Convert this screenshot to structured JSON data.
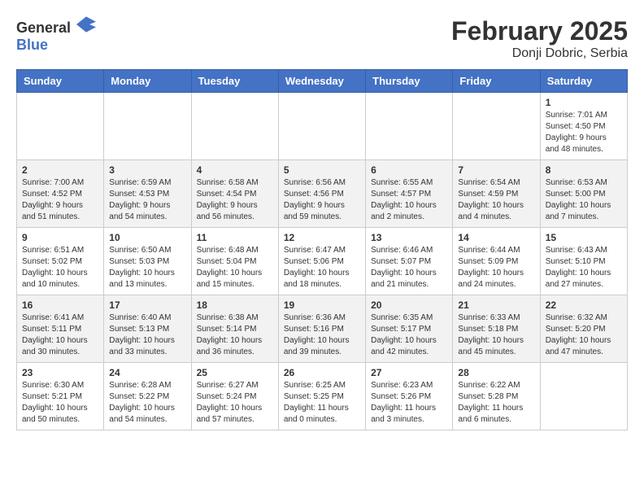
{
  "header": {
    "logo": {
      "general": "General",
      "blue": "Blue"
    },
    "title": "February 2025",
    "subtitle": "Donji Dobric, Serbia"
  },
  "days_of_week": [
    "Sunday",
    "Monday",
    "Tuesday",
    "Wednesday",
    "Thursday",
    "Friday",
    "Saturday"
  ],
  "weeks": [
    {
      "days": [
        {
          "number": "",
          "info": ""
        },
        {
          "number": "",
          "info": ""
        },
        {
          "number": "",
          "info": ""
        },
        {
          "number": "",
          "info": ""
        },
        {
          "number": "",
          "info": ""
        },
        {
          "number": "",
          "info": ""
        },
        {
          "number": "1",
          "info": "Sunrise: 7:01 AM\nSunset: 4:50 PM\nDaylight: 9 hours and 48 minutes."
        }
      ]
    },
    {
      "days": [
        {
          "number": "2",
          "info": "Sunrise: 7:00 AM\nSunset: 4:52 PM\nDaylight: 9 hours and 51 minutes."
        },
        {
          "number": "3",
          "info": "Sunrise: 6:59 AM\nSunset: 4:53 PM\nDaylight: 9 hours and 54 minutes."
        },
        {
          "number": "4",
          "info": "Sunrise: 6:58 AM\nSunset: 4:54 PM\nDaylight: 9 hours and 56 minutes."
        },
        {
          "number": "5",
          "info": "Sunrise: 6:56 AM\nSunset: 4:56 PM\nDaylight: 9 hours and 59 minutes."
        },
        {
          "number": "6",
          "info": "Sunrise: 6:55 AM\nSunset: 4:57 PM\nDaylight: 10 hours and 2 minutes."
        },
        {
          "number": "7",
          "info": "Sunrise: 6:54 AM\nSunset: 4:59 PM\nDaylight: 10 hours and 4 minutes."
        },
        {
          "number": "8",
          "info": "Sunrise: 6:53 AM\nSunset: 5:00 PM\nDaylight: 10 hours and 7 minutes."
        }
      ]
    },
    {
      "days": [
        {
          "number": "9",
          "info": "Sunrise: 6:51 AM\nSunset: 5:02 PM\nDaylight: 10 hours and 10 minutes."
        },
        {
          "number": "10",
          "info": "Sunrise: 6:50 AM\nSunset: 5:03 PM\nDaylight: 10 hours and 13 minutes."
        },
        {
          "number": "11",
          "info": "Sunrise: 6:48 AM\nSunset: 5:04 PM\nDaylight: 10 hours and 15 minutes."
        },
        {
          "number": "12",
          "info": "Sunrise: 6:47 AM\nSunset: 5:06 PM\nDaylight: 10 hours and 18 minutes."
        },
        {
          "number": "13",
          "info": "Sunrise: 6:46 AM\nSunset: 5:07 PM\nDaylight: 10 hours and 21 minutes."
        },
        {
          "number": "14",
          "info": "Sunrise: 6:44 AM\nSunset: 5:09 PM\nDaylight: 10 hours and 24 minutes."
        },
        {
          "number": "15",
          "info": "Sunrise: 6:43 AM\nSunset: 5:10 PM\nDaylight: 10 hours and 27 minutes."
        }
      ]
    },
    {
      "days": [
        {
          "number": "16",
          "info": "Sunrise: 6:41 AM\nSunset: 5:11 PM\nDaylight: 10 hours and 30 minutes."
        },
        {
          "number": "17",
          "info": "Sunrise: 6:40 AM\nSunset: 5:13 PM\nDaylight: 10 hours and 33 minutes."
        },
        {
          "number": "18",
          "info": "Sunrise: 6:38 AM\nSunset: 5:14 PM\nDaylight: 10 hours and 36 minutes."
        },
        {
          "number": "19",
          "info": "Sunrise: 6:36 AM\nSunset: 5:16 PM\nDaylight: 10 hours and 39 minutes."
        },
        {
          "number": "20",
          "info": "Sunrise: 6:35 AM\nSunset: 5:17 PM\nDaylight: 10 hours and 42 minutes."
        },
        {
          "number": "21",
          "info": "Sunrise: 6:33 AM\nSunset: 5:18 PM\nDaylight: 10 hours and 45 minutes."
        },
        {
          "number": "22",
          "info": "Sunrise: 6:32 AM\nSunset: 5:20 PM\nDaylight: 10 hours and 47 minutes."
        }
      ]
    },
    {
      "days": [
        {
          "number": "23",
          "info": "Sunrise: 6:30 AM\nSunset: 5:21 PM\nDaylight: 10 hours and 50 minutes."
        },
        {
          "number": "24",
          "info": "Sunrise: 6:28 AM\nSunset: 5:22 PM\nDaylight: 10 hours and 54 minutes."
        },
        {
          "number": "25",
          "info": "Sunrise: 6:27 AM\nSunset: 5:24 PM\nDaylight: 10 hours and 57 minutes."
        },
        {
          "number": "26",
          "info": "Sunrise: 6:25 AM\nSunset: 5:25 PM\nDaylight: 11 hours and 0 minutes."
        },
        {
          "number": "27",
          "info": "Sunrise: 6:23 AM\nSunset: 5:26 PM\nDaylight: 11 hours and 3 minutes."
        },
        {
          "number": "28",
          "info": "Sunrise: 6:22 AM\nSunset: 5:28 PM\nDaylight: 11 hours and 6 minutes."
        },
        {
          "number": "",
          "info": ""
        }
      ]
    }
  ]
}
